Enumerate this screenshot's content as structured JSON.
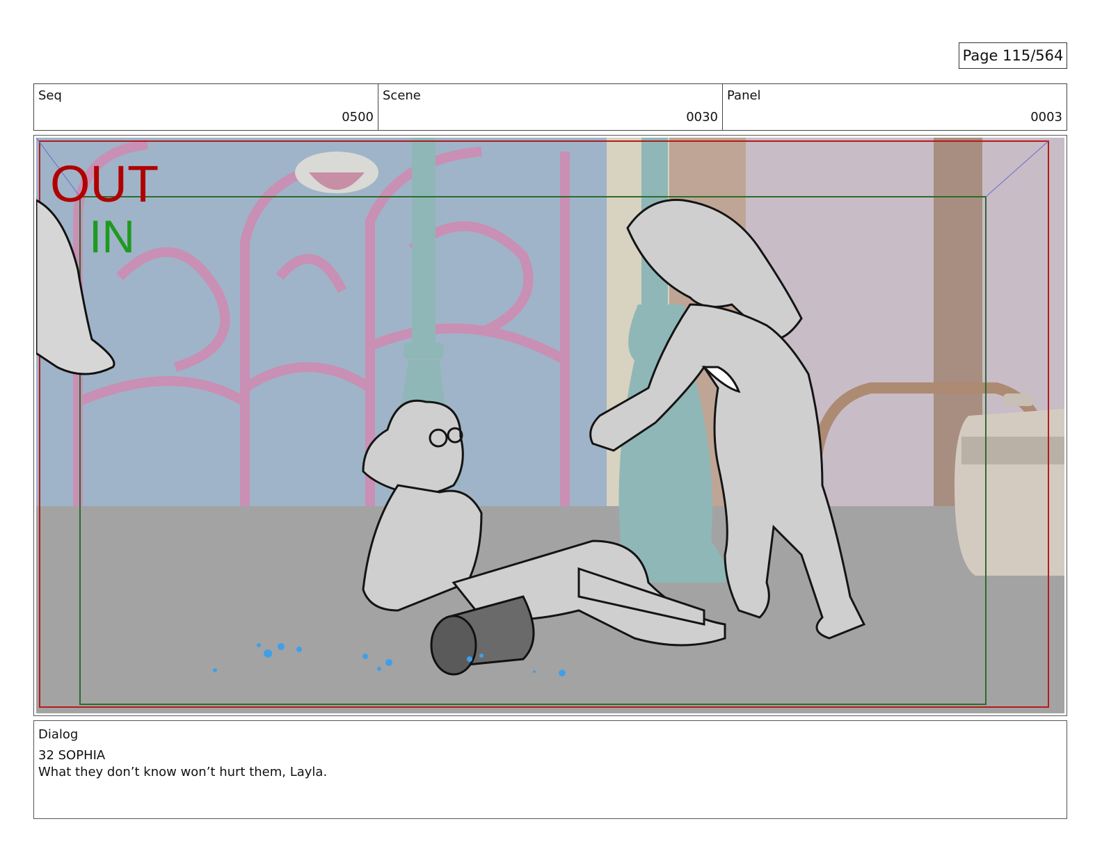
{
  "page": {
    "label": "Page 115/564"
  },
  "header": {
    "seq": {
      "label": "Seq",
      "value": "0500"
    },
    "scene": {
      "label": "Scene",
      "value": "0030"
    },
    "panel": {
      "label": "Panel",
      "value": "0003"
    }
  },
  "frame_marks": {
    "out_label": "OUT",
    "in_label": "IN",
    "out_color": "#b00000",
    "in_color": "#1f9a1f"
  },
  "dialog": {
    "label": "Dialog",
    "speaker": "32 SOPHIA",
    "line": "What they don’t know won’t hurt them, Layla."
  }
}
